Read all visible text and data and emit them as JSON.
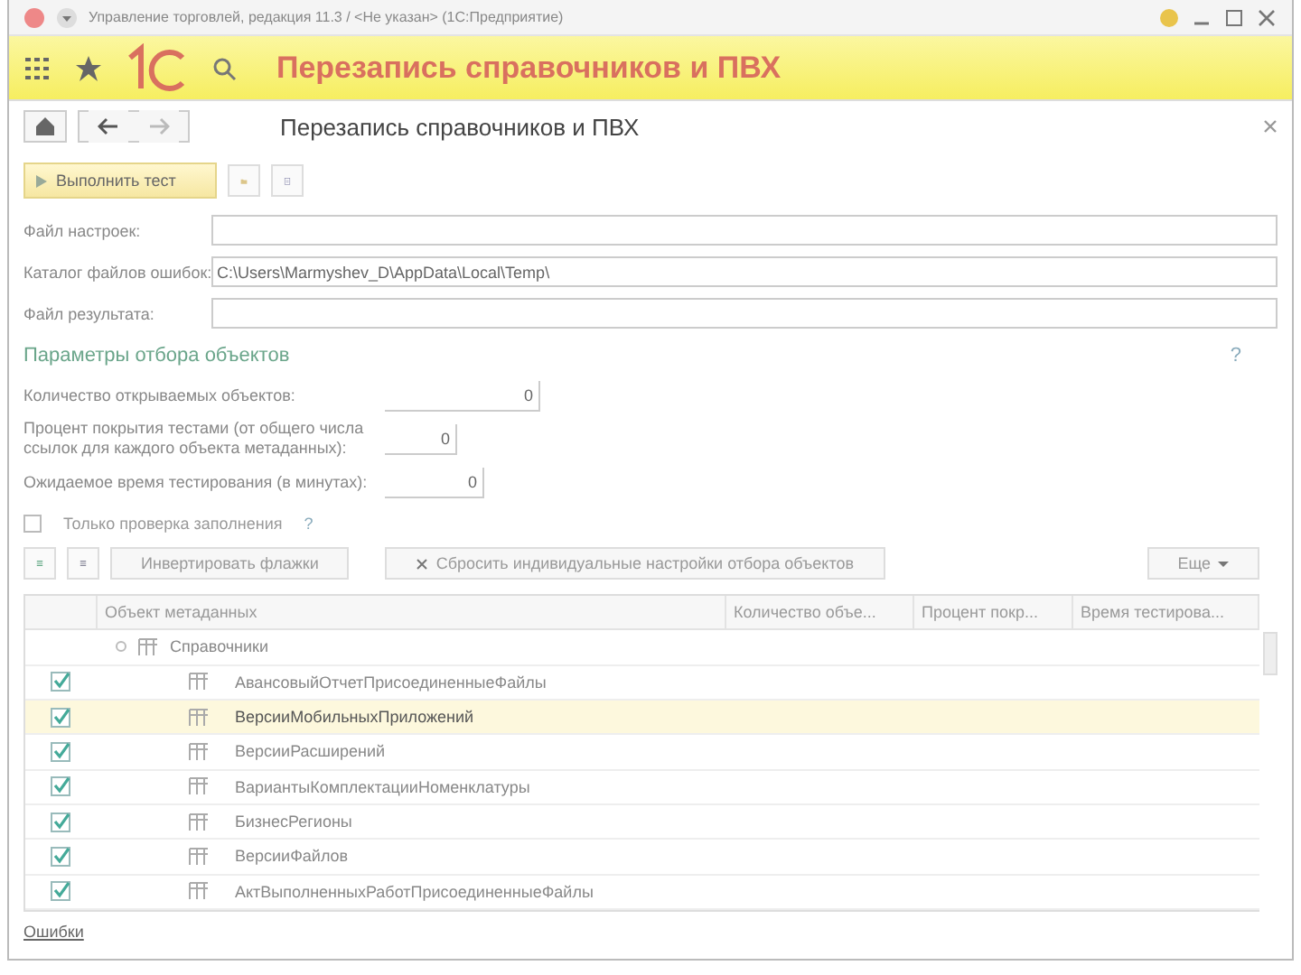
{
  "window": {
    "title": "Управление торговлей, редакция 11.3 / <Не указан> (1С:Предприятие)"
  },
  "header": {
    "banner_title": "Перезапись справочников и ПВХ",
    "form_title": "Перезапись справочников и ПВХ"
  },
  "commands": {
    "run_label": "Выполнить тест"
  },
  "fields": [
    {
      "label": "Файл настроек:"
    },
    {
      "label": "Каталог файлов ошибок:",
      "value": "C:\\Users\\Marmyshev_D\\AppData\\Local\\Temp\\"
    },
    {
      "label": "Файл результата:"
    }
  ],
  "section": {
    "title": "Параметры отбора объектов",
    "help": "?"
  },
  "params": [
    {
      "label": "Количество открываемых объектов:",
      "value": "0"
    },
    {
      "label": "Процент покрытия тестами (от общего числа ссылок для каждого объекта метаданных):",
      "value": "0"
    },
    {
      "label": "Ожидаемое время тестирования (в минутах):",
      "value": "0"
    }
  ],
  "fill_check": {
    "label": "Только проверка заполнения",
    "checked": false,
    "help": "?"
  },
  "table_toolbar": {
    "invert_label": "Инвертировать флажки",
    "reset_label": "Сбросить индивидуальные настройки отбора объектов",
    "more_label": "Еще"
  },
  "table": {
    "columns": [
      "Объект метаданных",
      "Количество объе...",
      "Процент покр...",
      "Время тестирова..."
    ],
    "group": {
      "name": "Справочники",
      "expanded": true
    },
    "rows": [
      {
        "name": "АвансовыйОтчетПрисоединенныеФайлы",
        "checked": true,
        "selected": false
      },
      {
        "name": "ВерсииМобильныхПриложений",
        "checked": true,
        "selected": true
      },
      {
        "name": "ВерсииРасширений",
        "checked": true,
        "selected": false
      },
      {
        "name": "ВариантыКомплектацииНоменклатуры",
        "checked": true,
        "selected": false
      },
      {
        "name": "БизнесРегионы",
        "checked": true,
        "selected": false
      },
      {
        "name": "ВерсииФайлов",
        "checked": true,
        "selected": false
      },
      {
        "name": "АктВыполненныхРаботПрисоединенныеФайлы",
        "checked": true,
        "selected": false
      }
    ]
  },
  "footer": {
    "link": "Ошибки"
  }
}
